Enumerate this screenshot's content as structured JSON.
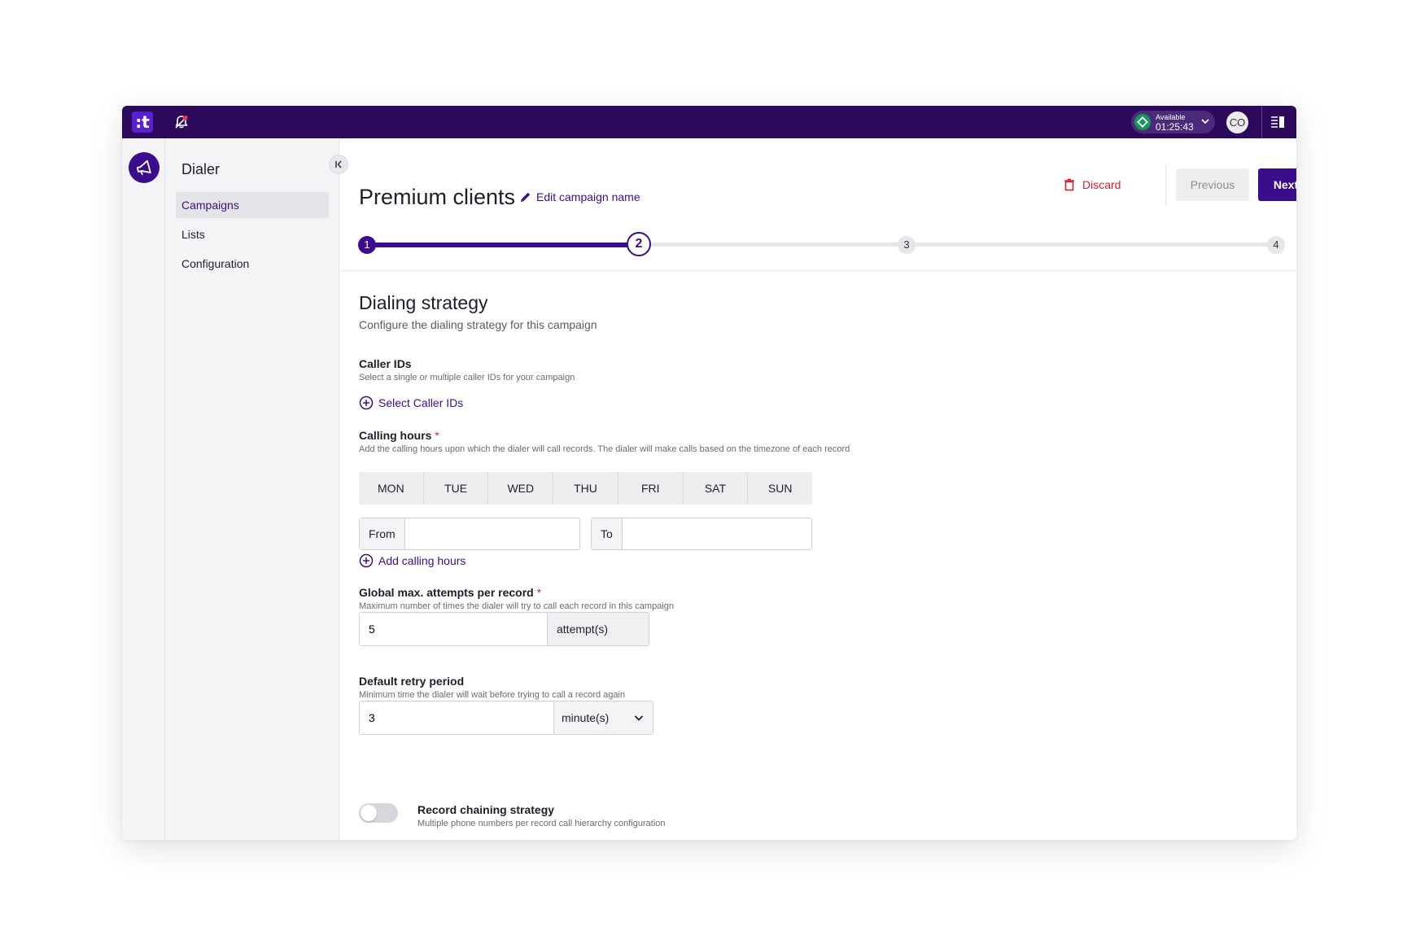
{
  "topbar": {
    "logo_text": ":t",
    "status_label": "Available",
    "status_time": "01:25:43",
    "avatar_initials": "CO"
  },
  "sidebar": {
    "title": "Dialer",
    "items": [
      {
        "label": "Campaigns",
        "active": true
      },
      {
        "label": "Lists",
        "active": false
      },
      {
        "label": "Configuration",
        "active": false
      }
    ]
  },
  "header": {
    "campaign_name": "Premium clients",
    "edit_label": "Edit campaign name",
    "discard_label": "Discard",
    "previous_label": "Previous",
    "next_label": "Next"
  },
  "stepper": {
    "steps": [
      "1",
      "2",
      "3",
      "4"
    ],
    "current_step": 2
  },
  "section": {
    "title": "Dialing strategy",
    "subtitle": "Configure the dialing strategy for this campaign"
  },
  "caller_ids": {
    "label": "Caller IDs",
    "helper": "Select a single or multiple caller IDs for your campaign",
    "action": "Select Caller IDs"
  },
  "calling_hours": {
    "label": "Calling hours",
    "required_mark": "*",
    "helper": "Add the calling hours upon which the dialer will call records. The dialer will make calls based on the timezone of each record",
    "days": [
      "MON",
      "TUE",
      "WED",
      "THU",
      "FRI",
      "SAT",
      "SUN"
    ],
    "from_label": "From",
    "from_value": "",
    "to_label": "To",
    "to_value": "",
    "add_action": "Add calling hours"
  },
  "max_attempts": {
    "label": "Global max. attempts per record",
    "required_mark": "*",
    "helper": "Maximum number of times the dialer will try to call each record in this campaign",
    "value": "5",
    "unit": "attempt(s)"
  },
  "retry_period": {
    "label": "Default retry period",
    "helper": "Minimum time the dialer will wait before trying to call a record again",
    "value": "3",
    "unit": "minute(s)"
  },
  "record_chaining": {
    "label": "Record chaining strategy",
    "helper": "Multiple phone numbers per record call hierarchy configuration",
    "enabled": false
  },
  "colors": {
    "brand": "#2b0a5c",
    "accent": "#3b0d8c",
    "danger": "#d01f2e",
    "status_available": "#17965a"
  }
}
